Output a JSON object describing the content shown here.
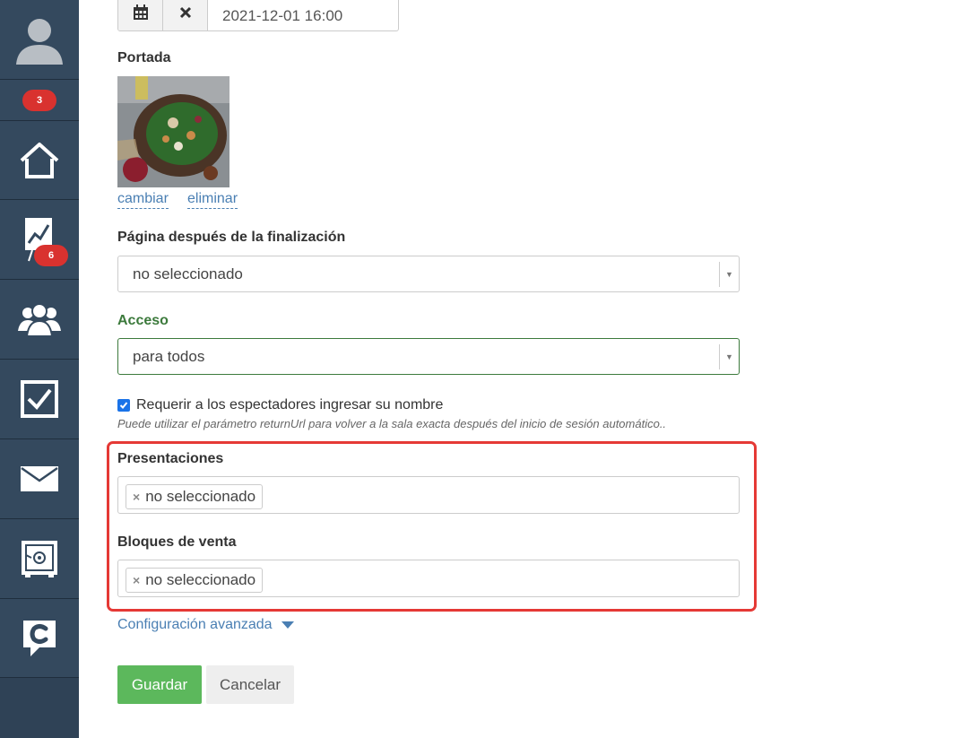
{
  "sidebar": {
    "notifications_badge": "3",
    "stats_badge": "6"
  },
  "date": {
    "value": "2021-12-01 16:00"
  },
  "cover": {
    "label": "Portada",
    "change_link": "cambiar",
    "delete_link": "eliminar"
  },
  "after_page": {
    "label": "Página después de la finalización",
    "value": "no seleccionado"
  },
  "access": {
    "label": "Acceso",
    "value": "para todos"
  },
  "require_name": {
    "label": "Requerir a los espectadores ingresar su nombre",
    "checked": true,
    "hint": "Puede utilizar el parámetro returnUrl para volver a la sala exacta después del inicio de sesión automático.."
  },
  "presentations": {
    "label": "Presentaciones",
    "tag": "no seleccionado"
  },
  "sales_blocks": {
    "label": "Bloques de venta",
    "tag": "no seleccionado"
  },
  "advanced": {
    "label": "Configuración avanzada"
  },
  "buttons": {
    "save": "Guardar",
    "cancel": "Cancelar"
  },
  "colors": {
    "sidebar": "#34495e",
    "badge": "#d9322f",
    "save": "#5cb85c",
    "link": "#4a7fb3",
    "highlight": "#e53935",
    "access_label": "#3c7a3c"
  }
}
